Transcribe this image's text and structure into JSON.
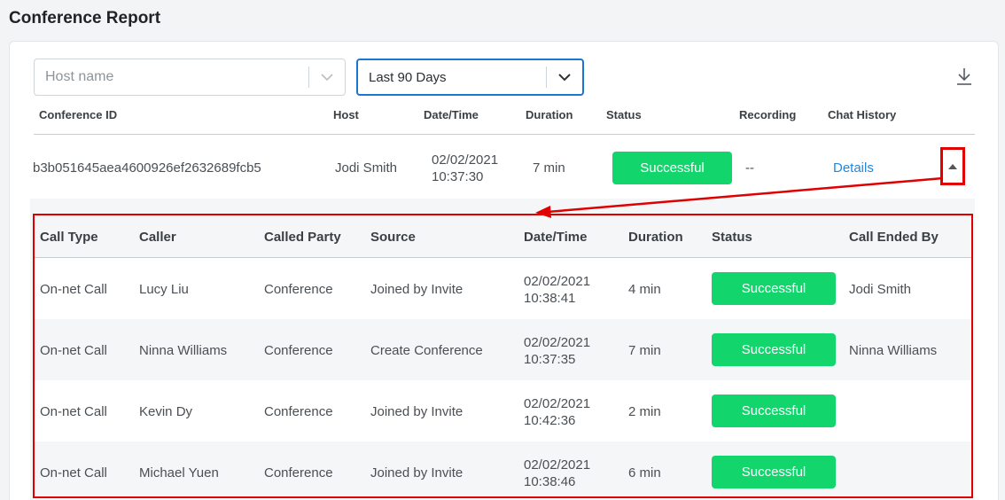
{
  "page": {
    "title": "Conference Report"
  },
  "filters": {
    "host": {
      "placeholder": "Host name",
      "icon": "chevron-down-icon"
    },
    "range": {
      "value": "Last 90 Days",
      "icon": "chevron-down-icon"
    },
    "download_icon": "download-icon"
  },
  "main_table": {
    "columns": [
      "Conference ID",
      "Host",
      "Date/Time",
      "Duration",
      "Status",
      "Recording",
      "Chat History"
    ],
    "row": {
      "conference_id": "b3b051645aea4600926ef2632689fcb5",
      "host": "Jodi Smith",
      "date": "02/02/2021",
      "time": "10:37:30",
      "duration": "7 min",
      "status": "Successful",
      "recording": "--",
      "chat_history": "Details"
    }
  },
  "call_table": {
    "columns": [
      "Call Type",
      "Caller",
      "Called Party",
      "Source",
      "Date/Time",
      "Duration",
      "Status",
      "Call Ended By"
    ],
    "rows": [
      {
        "call_type": "On-net Call",
        "caller": "Lucy Liu",
        "called_party": "Conference",
        "source": "Joined by Invite",
        "date": "02/02/2021",
        "time": "10:38:41",
        "duration": "4 min",
        "status": "Successful",
        "ended_by": "Jodi Smith"
      },
      {
        "call_type": "On-net Call",
        "caller": "Ninna Williams",
        "called_party": "Conference",
        "source": "Create Conference",
        "date": "02/02/2021",
        "time": "10:37:35",
        "duration": "7 min",
        "status": "Successful",
        "ended_by": "Ninna Williams"
      },
      {
        "call_type": "On-net Call",
        "caller": "Kevin Dy",
        "called_party": "Conference",
        "source": "Joined by Invite",
        "date": "02/02/2021",
        "time": "10:42:36",
        "duration": "2 min",
        "status": "Successful",
        "ended_by": ""
      },
      {
        "call_type": "On-net Call",
        "caller": "Michael Yuen",
        "called_party": "Conference",
        "source": "Joined by Invite",
        "date": "02/02/2021",
        "time": "10:38:46",
        "duration": "6 min",
        "status": "Successful",
        "ended_by": ""
      }
    ]
  },
  "colors": {
    "success": "#12d66c",
    "highlight": "#e00000",
    "link": "#1e88e5",
    "focus": "#1976d2"
  }
}
